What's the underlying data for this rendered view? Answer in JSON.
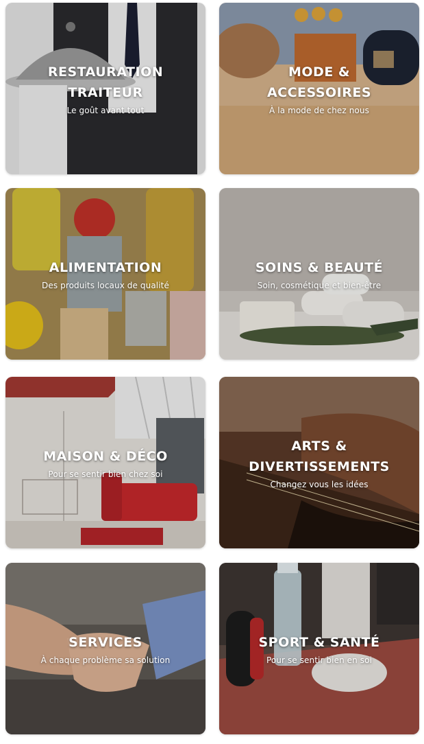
{
  "categories": [
    {
      "id": "restauration",
      "title": "RESTAURATION\nTRAITEUR",
      "subtitle": "Le goût avant tout",
      "color": "#cfcfcf"
    },
    {
      "id": "mode",
      "title": "MODE &\nACCESSOIRES",
      "subtitle": "À la mode de chez nous",
      "color": "#bd8a5e"
    },
    {
      "id": "alimentation",
      "title": "ALIMENTATION",
      "subtitle": "Des produits locaux de qualité",
      "color": "#b89b45"
    },
    {
      "id": "soins",
      "title": "SOINS & BEAUTÉ",
      "subtitle": "Soin, cosmétique et bien-être",
      "color": "#d4d2cd"
    },
    {
      "id": "maison",
      "title": "MAISON & DÉCO",
      "subtitle": "Pour se sentir bien chez soi",
      "color": "#e2ddd6"
    },
    {
      "id": "arts",
      "title": "ARTS &\nDIVERTISSEMENTS",
      "subtitle": "Changez vous les idées",
      "color": "#6e4a33"
    },
    {
      "id": "services",
      "title": "SERVICES",
      "subtitle": "À chaque problème sa solution",
      "color": "#6f6a66"
    },
    {
      "id": "sport",
      "title": "SPORT & SANTÉ",
      "subtitle": "Pour se sentir bien en soi",
      "color": "#7b4f45"
    }
  ]
}
